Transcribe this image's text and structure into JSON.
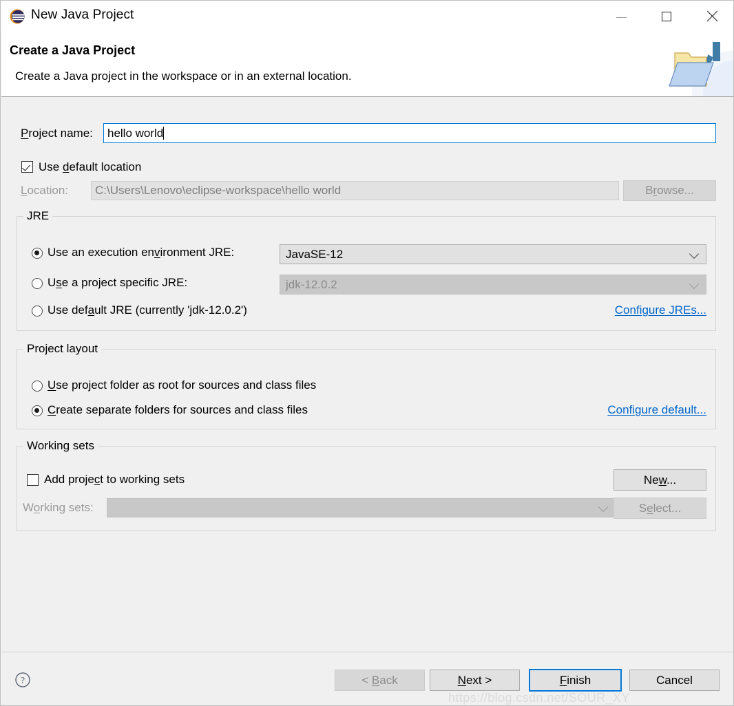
{
  "window": {
    "title": "New Java Project",
    "icon": "eclipse-icon",
    "buttons": {
      "minimize": "minimize-icon",
      "maximize": "maximize-icon",
      "close": "close-icon"
    }
  },
  "header": {
    "title": "Create a Java Project",
    "description": "Create a Java project in the workspace or in an external location.",
    "banner_icon": "java-project-folder-icon"
  },
  "form": {
    "project_name_label": "Project name:",
    "project_name_value": "hello world",
    "use_default_location_label": "Use default location",
    "use_default_location_checked": true,
    "location_label": "Location:",
    "location_value": "C:\\Users\\Lenovo\\eclipse-workspace\\hello world",
    "location_enabled": false,
    "browse_label": "Browse...",
    "browse_enabled": false
  },
  "jre": {
    "group_title": "JRE",
    "options": [
      {
        "label": "Use an execution environment JRE:",
        "selected": true
      },
      {
        "label": "Use a project specific JRE:",
        "selected": false
      },
      {
        "label": "Use default JRE (currently 'jdk-12.0.2')",
        "selected": false
      }
    ],
    "execution_env_value": "JavaSE-12",
    "execution_env_enabled": true,
    "project_jre_value": "jdk-12.0.2",
    "project_jre_enabled": false,
    "configure_link": "Configure JREs..."
  },
  "project_layout": {
    "group_title": "Project layout",
    "options": [
      {
        "label": "Use project folder as root for sources and class files",
        "selected": false
      },
      {
        "label": "Create separate folders for sources and class files",
        "selected": true
      }
    ],
    "configure_link": "Configure default..."
  },
  "working_sets": {
    "group_title": "Working sets",
    "add_checkbox_label": "Add project to working sets",
    "add_checkbox_checked": false,
    "new_button": "New...",
    "working_sets_label": "Working sets:",
    "working_sets_value": "",
    "working_sets_enabled": false,
    "select_button": "Select...",
    "select_enabled": false
  },
  "footer": {
    "help_icon": "help-icon",
    "back_button": "< Back",
    "back_enabled": false,
    "next_button": "Next >",
    "finish_button": "Finish",
    "cancel_button": "Cancel",
    "default_button": "Finish"
  },
  "watermark": "https://blog.csdn.net/SOUR_XY",
  "colors": {
    "accent": "#0078d7",
    "link": "#0066cc",
    "dialog_bg": "#f0f0f0",
    "header_bg": "#ffffff"
  }
}
